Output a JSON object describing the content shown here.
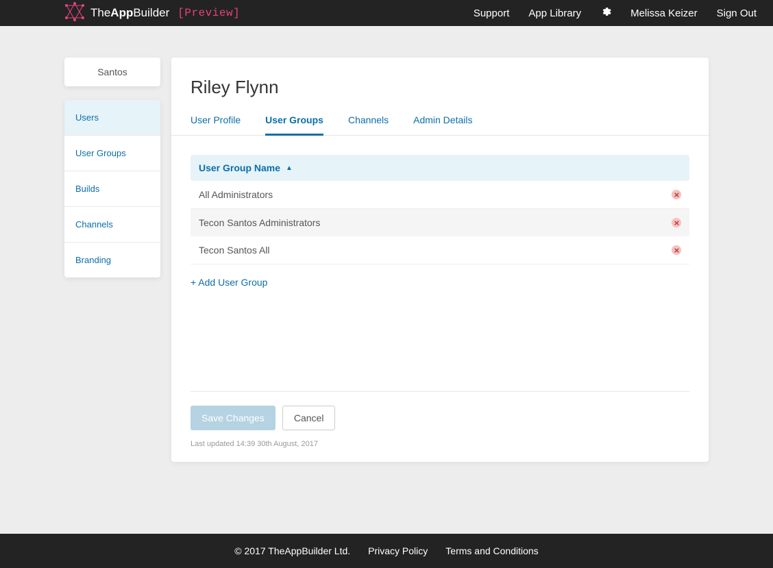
{
  "header": {
    "brand_the": "The",
    "brand_app": "App",
    "brand_builder": "Builder",
    "preview": "[Preview]",
    "nav": {
      "support": "Support",
      "app_library": "App Library",
      "user_name": "Melissa Keizer",
      "sign_out": "Sign Out"
    }
  },
  "sidebar": {
    "org": "Santos",
    "items": [
      {
        "label": "Users",
        "active": true
      },
      {
        "label": "User Groups",
        "active": false
      },
      {
        "label": "Builds",
        "active": false
      },
      {
        "label": "Channels",
        "active": false
      },
      {
        "label": "Branding",
        "active": false
      }
    ]
  },
  "main": {
    "title": "Riley Flynn",
    "tabs": [
      {
        "label": "User Profile",
        "active": false
      },
      {
        "label": "User Groups",
        "active": true
      },
      {
        "label": "Channels",
        "active": false
      },
      {
        "label": "Admin Details",
        "active": false
      }
    ],
    "table": {
      "column_header": "User Group Name",
      "rows": [
        {
          "name": "All Administrators"
        },
        {
          "name": "Tecon Santos Administrators"
        },
        {
          "name": "Tecon Santos All"
        }
      ]
    },
    "add_link": "+ Add User Group",
    "actions": {
      "save": "Save Changes",
      "cancel": "Cancel"
    },
    "last_updated": "Last updated 14:39 30th August, 2017"
  },
  "footer": {
    "copyright": "© 2017 TheAppBuilder Ltd.",
    "privacy": "Privacy Policy",
    "terms": "Terms and Conditions"
  }
}
